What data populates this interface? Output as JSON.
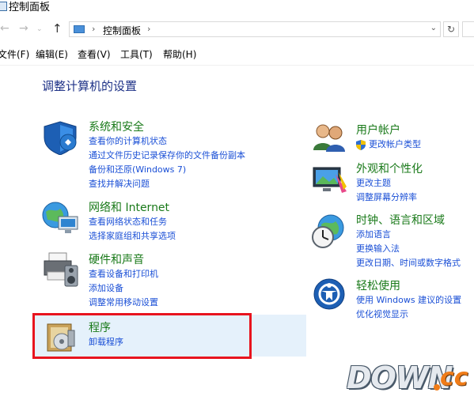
{
  "window": {
    "title": "控制面板"
  },
  "navigation": {
    "back_icon": "left-arrow-icon",
    "forward_icon": "right-arrow-icon",
    "up_icon": "up-arrow-icon",
    "breadcrumb_sep": "›",
    "breadcrumb": "控制面板",
    "breadcrumb_after": "›",
    "dropdown": "⌄",
    "refresh": "↻"
  },
  "menu": [
    {
      "label": "文件(F)"
    },
    {
      "label": "编辑(E)"
    },
    {
      "label": "查看(V)"
    },
    {
      "label": "工具(T)"
    },
    {
      "label": "帮助(H)"
    }
  ],
  "heading": "调整计算机的设置",
  "categories": {
    "security": {
      "title": "系统和安全",
      "links": [
        "查看你的计算机状态",
        "通过文件历史记录保存你的文件备份副本",
        "备份和还原(Windows 7)",
        "查找并解决问题"
      ]
    },
    "network": {
      "title": "网络和 Internet",
      "links": [
        "查看网络状态和任务",
        "选择家庭组和共享选项"
      ]
    },
    "hardware": {
      "title": "硬件和声音",
      "links": [
        "查看设备和打印机",
        "添加设备",
        "调整常用移动设置"
      ]
    },
    "programs": {
      "title": "程序",
      "links": [
        "卸载程序"
      ]
    },
    "users": {
      "title": "用户帐户",
      "links": [
        "更改帐户类型"
      ]
    },
    "appearance": {
      "title": "外观和个性化",
      "links": [
        "更改主题",
        "调整屏幕分辨率"
      ]
    },
    "clock": {
      "title": "时钟、语言和区域",
      "links": [
        "添加语言",
        "更换输入法",
        "更改日期、时间或数字格式"
      ]
    },
    "ease": {
      "title": "轻松使用",
      "links": [
        "使用 Windows 建议的设置",
        "优化视觉显示"
      ]
    }
  },
  "watermark": {
    "main": "DOWN",
    "suffix": "cc"
  },
  "colors": {
    "heading": "#1e3287",
    "category_title": "#1a7a1a",
    "link": "#1a4fd6",
    "highlight": "#e5f1fb",
    "annotation": "#e8141e"
  }
}
